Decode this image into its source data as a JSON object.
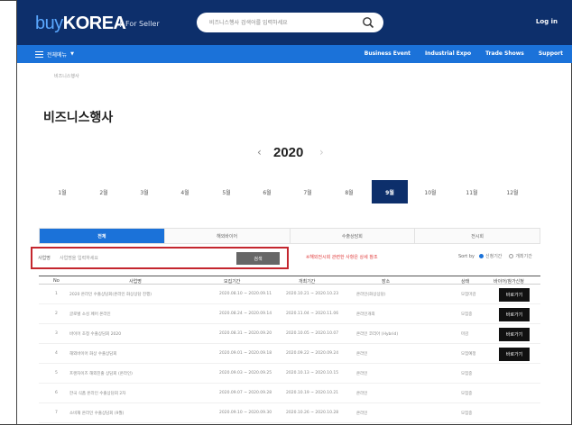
{
  "header": {
    "logo_buy": "buy",
    "logo_korea": "KOREA",
    "logo_sub": "For Seller",
    "search_placeholder": "비즈니스행사 검색어를 입력하세요",
    "login": "Log in"
  },
  "nav": {
    "menu_label": "전체메뉴",
    "links": [
      "Business Event",
      "Industrial Expo",
      "Trade Shows",
      "Support"
    ]
  },
  "breadcrumb": "비즈니스행사",
  "page_title": "비즈니스행사",
  "year": {
    "prev": "‹",
    "value": "2020",
    "next": "›"
  },
  "months": [
    {
      "label": "1월",
      "active": false
    },
    {
      "label": "2월",
      "active": false
    },
    {
      "label": "3월",
      "active": false
    },
    {
      "label": "4월",
      "active": false
    },
    {
      "label": "5월",
      "active": false
    },
    {
      "label": "6월",
      "active": false
    },
    {
      "label": "7월",
      "active": false
    },
    {
      "label": "8월",
      "active": false
    },
    {
      "label": "9월",
      "active": true
    },
    {
      "label": "10월",
      "active": false
    },
    {
      "label": "11월",
      "active": false
    },
    {
      "label": "12월",
      "active": false
    }
  ],
  "tabs": [
    {
      "label": "전체",
      "active": true
    },
    {
      "label": "해외바이어",
      "active": false
    },
    {
      "label": "수출상담회",
      "active": false
    },
    {
      "label": "전시회",
      "active": false
    }
  ],
  "filter": {
    "label": "사업명",
    "placeholder": "사업명을 입력하세요",
    "button": "검색"
  },
  "notice": "※해외전시회 관련한 사항은 상세 참조",
  "sort": {
    "label": "Sort by",
    "options": [
      {
        "label": "신청기간",
        "checked": true
      },
      {
        "label": "개최기간",
        "checked": false
      }
    ]
  },
  "table": {
    "headers": [
      "No",
      "사업명",
      "모집기간",
      "개최기간",
      "장소",
      "상태",
      "바이어/참가신청"
    ],
    "rows": [
      {
        "no": "1",
        "title": "2020 온라인 수출상담회(온라인 화상상담 진행)",
        "recruit": "2020.08.10 ~ 2020.09.11",
        "held": "2020.10.21 ~ 2020.10.23",
        "place": "온라인(화상상담)",
        "status": "모집마감",
        "button": "바로가기"
      },
      {
        "no": "2",
        "title": "글로벌 소싱 페어 온라인",
        "recruit": "2020.08.24 ~ 2020.09.14",
        "held": "2020.11.04 ~ 2020.11.06",
        "place": "온라인개최",
        "status": "모집중",
        "button": "바로가기"
      },
      {
        "no": "3",
        "title": "바이어 초청 수출상담회 2020",
        "recruit": "2020.08.31 ~ 2020.09.20",
        "held": "2020.10.05 ~ 2020.10.07",
        "place": "온라인 코리아 (Hybrid)",
        "status": "마감",
        "button": "바로가기"
      },
      {
        "no": "4",
        "title": "해외바이어 화상 수출상담회",
        "recruit": "2020.09.01 ~ 2020.09.18",
        "held": "2020.09.22 ~ 2020.09.24",
        "place": "온라인",
        "status": "모집예정",
        "button": "바로가기"
      },
      {
        "no": "5",
        "title": "프랜차이즈 해외진출 상담회 (온라인)",
        "recruit": "2020.09.03 ~ 2020.09.25",
        "held": "2020.10.13 ~ 2020.10.15",
        "place": "온라인",
        "status": "모집중",
        "button": ""
      },
      {
        "no": "6",
        "title": "한국 식품 온라인 수출상담회 2차",
        "recruit": "2020.09.07 ~ 2020.09.28",
        "held": "2020.10.19 ~ 2020.10.21",
        "place": "온라인",
        "status": "모집중",
        "button": ""
      },
      {
        "no": "7",
        "title": "소비재 온라인 수출상담회 (9월)",
        "recruit": "2020.09.10 ~ 2020.09.30",
        "held": "2020.10.26 ~ 2020.10.28",
        "place": "온라인",
        "status": "모집중",
        "button": ""
      }
    ]
  },
  "colors": {
    "navy": "#0d2f6b",
    "blue": "#1b72d9",
    "highlight_red": "#c4262e",
    "notice_red": "#e03a3a"
  }
}
